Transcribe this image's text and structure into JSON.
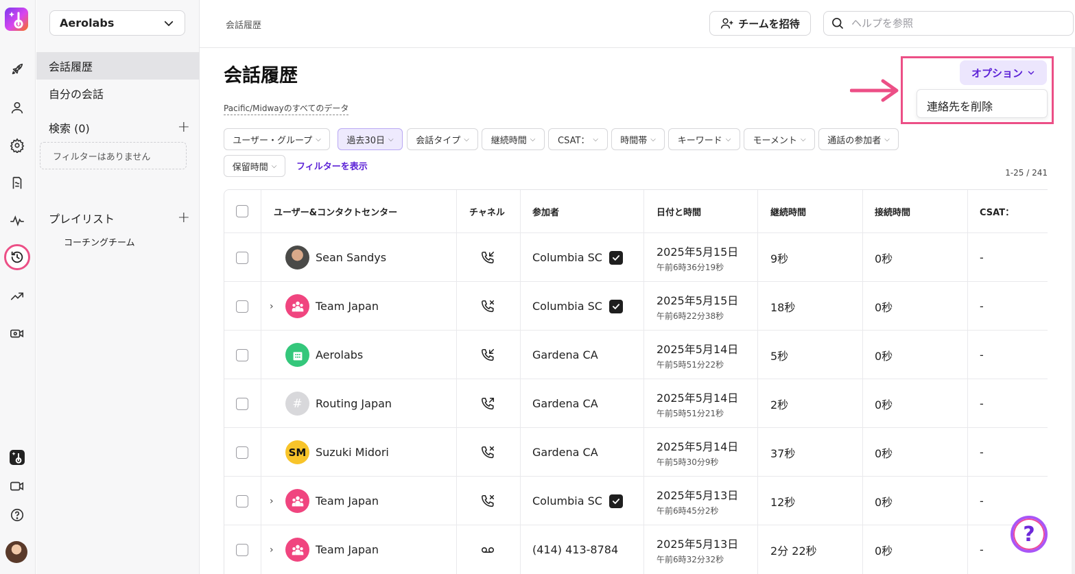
{
  "sidebar": {
    "org": "Aerolabs",
    "items": [
      {
        "label": "会話履歴"
      },
      {
        "label": "自分の会話"
      }
    ],
    "search_label": "検索 (0)",
    "no_filter": "フィルターはありません",
    "playlist_label": "プレイリスト",
    "playlist_item": "コーチングチーム"
  },
  "topbar": {
    "breadcrumb": "会話履歴",
    "invite_label": "チームを招待",
    "help_placeholder": "ヘルプを参照"
  },
  "main": {
    "title": "会話履歴",
    "subtitle": "Pacific/Midwayのすべてのデータ",
    "options_label": "オプション",
    "dropdown_item": "連絡先を削除",
    "filters": [
      "ユーザー・グループ",
      "過去30日",
      "会話タイプ",
      "継続時間",
      "CSAT：",
      "時間帯",
      "キーワード",
      "モーメント",
      "通話の参加者",
      "保留時間"
    ],
    "show_filters": "フィルターを表示",
    "count": "1-25 / 241"
  },
  "table": {
    "headers": [
      "ユーザー&コンタクトセンター",
      "チャネル",
      "参加者",
      "日付と時間",
      "継続時間",
      "接続時間",
      "CSAT："
    ],
    "rows": [
      {
        "name": "Sean Sandys",
        "avatar": "photo",
        "initials": "",
        "expand": false,
        "channel": "phone-incoming-icon",
        "participant": "Columbia SC",
        "verified": true,
        "date": "2025年5月15日",
        "time": "午前6時36分19秒",
        "duration": "9秒",
        "connect": "0秒",
        "csat": "-"
      },
      {
        "name": "Team Japan",
        "avatar": "team",
        "initials": "",
        "expand": true,
        "channel": "phone-missed-icon",
        "participant": "Columbia SC",
        "verified": true,
        "date": "2025年5月15日",
        "time": "午前6時22分38秒",
        "duration": "18秒",
        "connect": "0秒",
        "csat": "-"
      },
      {
        "name": "Aerolabs",
        "avatar": "office",
        "initials": "",
        "expand": false,
        "channel": "phone-incoming-icon",
        "participant": "Gardena CA",
        "verified": false,
        "date": "2025年5月14日",
        "time": "午前5時51分22秒",
        "duration": "5秒",
        "connect": "0秒",
        "csat": "-"
      },
      {
        "name": "Routing Japan",
        "avatar": "hash",
        "initials": "#",
        "expand": false,
        "channel": "phone-outgoing-icon",
        "participant": "Gardena CA",
        "verified": false,
        "date": "2025年5月14日",
        "time": "午前5時51分21秒",
        "duration": "2秒",
        "connect": "0秒",
        "csat": "-"
      },
      {
        "name": "Suzuki Midori",
        "avatar": "initials",
        "initials": "SM",
        "expand": false,
        "channel": "phone-missed-icon",
        "participant": "Gardena CA",
        "verified": false,
        "date": "2025年5月14日",
        "time": "午前5時30分9秒",
        "duration": "37秒",
        "connect": "0秒",
        "csat": "-"
      },
      {
        "name": "Team Japan",
        "avatar": "team",
        "initials": "",
        "expand": true,
        "channel": "phone-missed-icon",
        "participant": "Columbia SC",
        "verified": true,
        "date": "2025年5月13日",
        "time": "午前6時45分2秒",
        "duration": "12秒",
        "connect": "0秒",
        "csat": "-"
      },
      {
        "name": "Team Japan",
        "avatar": "team",
        "initials": "",
        "expand": true,
        "channel": "voicemail-icon",
        "participant": "(414) 413-8784",
        "verified": false,
        "date": "2025年5月13日",
        "time": "午前6時32分32秒",
        "duration": "2分 22秒",
        "connect": "0秒",
        "csat": "-"
      }
    ]
  },
  "help_fab": "?",
  "colors": {
    "accent": "#5b21d6",
    "highlight": "#ec4f86",
    "chip_selected": "#eeeafd"
  }
}
